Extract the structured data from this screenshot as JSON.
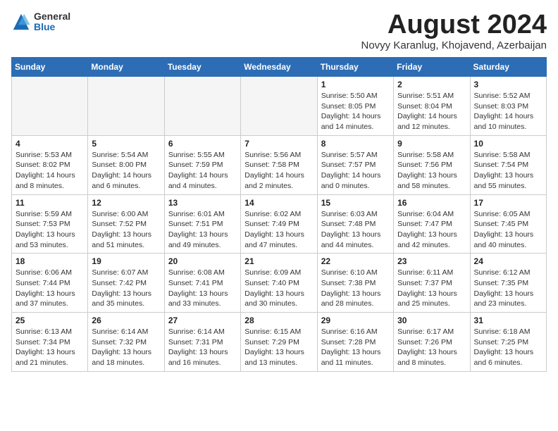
{
  "logo": {
    "general": "General",
    "blue": "Blue"
  },
  "title": "August 2024",
  "subtitle": "Novyy Karanlug, Khojavend, Azerbaijan",
  "headers": [
    "Sunday",
    "Monday",
    "Tuesday",
    "Wednesday",
    "Thursday",
    "Friday",
    "Saturday"
  ],
  "weeks": [
    [
      {
        "day": "",
        "info": ""
      },
      {
        "day": "",
        "info": ""
      },
      {
        "day": "",
        "info": ""
      },
      {
        "day": "",
        "info": ""
      },
      {
        "day": "1",
        "info": "Sunrise: 5:50 AM\nSunset: 8:05 PM\nDaylight: 14 hours\nand 14 minutes."
      },
      {
        "day": "2",
        "info": "Sunrise: 5:51 AM\nSunset: 8:04 PM\nDaylight: 14 hours\nand 12 minutes."
      },
      {
        "day": "3",
        "info": "Sunrise: 5:52 AM\nSunset: 8:03 PM\nDaylight: 14 hours\nand 10 minutes."
      }
    ],
    [
      {
        "day": "4",
        "info": "Sunrise: 5:53 AM\nSunset: 8:02 PM\nDaylight: 14 hours\nand 8 minutes."
      },
      {
        "day": "5",
        "info": "Sunrise: 5:54 AM\nSunset: 8:00 PM\nDaylight: 14 hours\nand 6 minutes."
      },
      {
        "day": "6",
        "info": "Sunrise: 5:55 AM\nSunset: 7:59 PM\nDaylight: 14 hours\nand 4 minutes."
      },
      {
        "day": "7",
        "info": "Sunrise: 5:56 AM\nSunset: 7:58 PM\nDaylight: 14 hours\nand 2 minutes."
      },
      {
        "day": "8",
        "info": "Sunrise: 5:57 AM\nSunset: 7:57 PM\nDaylight: 14 hours\nand 0 minutes."
      },
      {
        "day": "9",
        "info": "Sunrise: 5:58 AM\nSunset: 7:56 PM\nDaylight: 13 hours\nand 58 minutes."
      },
      {
        "day": "10",
        "info": "Sunrise: 5:58 AM\nSunset: 7:54 PM\nDaylight: 13 hours\nand 55 minutes."
      }
    ],
    [
      {
        "day": "11",
        "info": "Sunrise: 5:59 AM\nSunset: 7:53 PM\nDaylight: 13 hours\nand 53 minutes."
      },
      {
        "day": "12",
        "info": "Sunrise: 6:00 AM\nSunset: 7:52 PM\nDaylight: 13 hours\nand 51 minutes."
      },
      {
        "day": "13",
        "info": "Sunrise: 6:01 AM\nSunset: 7:51 PM\nDaylight: 13 hours\nand 49 minutes."
      },
      {
        "day": "14",
        "info": "Sunrise: 6:02 AM\nSunset: 7:49 PM\nDaylight: 13 hours\nand 47 minutes."
      },
      {
        "day": "15",
        "info": "Sunrise: 6:03 AM\nSunset: 7:48 PM\nDaylight: 13 hours\nand 44 minutes."
      },
      {
        "day": "16",
        "info": "Sunrise: 6:04 AM\nSunset: 7:47 PM\nDaylight: 13 hours\nand 42 minutes."
      },
      {
        "day": "17",
        "info": "Sunrise: 6:05 AM\nSunset: 7:45 PM\nDaylight: 13 hours\nand 40 minutes."
      }
    ],
    [
      {
        "day": "18",
        "info": "Sunrise: 6:06 AM\nSunset: 7:44 PM\nDaylight: 13 hours\nand 37 minutes."
      },
      {
        "day": "19",
        "info": "Sunrise: 6:07 AM\nSunset: 7:42 PM\nDaylight: 13 hours\nand 35 minutes."
      },
      {
        "day": "20",
        "info": "Sunrise: 6:08 AM\nSunset: 7:41 PM\nDaylight: 13 hours\nand 33 minutes."
      },
      {
        "day": "21",
        "info": "Sunrise: 6:09 AM\nSunset: 7:40 PM\nDaylight: 13 hours\nand 30 minutes."
      },
      {
        "day": "22",
        "info": "Sunrise: 6:10 AM\nSunset: 7:38 PM\nDaylight: 13 hours\nand 28 minutes."
      },
      {
        "day": "23",
        "info": "Sunrise: 6:11 AM\nSunset: 7:37 PM\nDaylight: 13 hours\nand 25 minutes."
      },
      {
        "day": "24",
        "info": "Sunrise: 6:12 AM\nSunset: 7:35 PM\nDaylight: 13 hours\nand 23 minutes."
      }
    ],
    [
      {
        "day": "25",
        "info": "Sunrise: 6:13 AM\nSunset: 7:34 PM\nDaylight: 13 hours\nand 21 minutes."
      },
      {
        "day": "26",
        "info": "Sunrise: 6:14 AM\nSunset: 7:32 PM\nDaylight: 13 hours\nand 18 minutes."
      },
      {
        "day": "27",
        "info": "Sunrise: 6:14 AM\nSunset: 7:31 PM\nDaylight: 13 hours\nand 16 minutes."
      },
      {
        "day": "28",
        "info": "Sunrise: 6:15 AM\nSunset: 7:29 PM\nDaylight: 13 hours\nand 13 minutes."
      },
      {
        "day": "29",
        "info": "Sunrise: 6:16 AM\nSunset: 7:28 PM\nDaylight: 13 hours\nand 11 minutes."
      },
      {
        "day": "30",
        "info": "Sunrise: 6:17 AM\nSunset: 7:26 PM\nDaylight: 13 hours\nand 8 minutes."
      },
      {
        "day": "31",
        "info": "Sunrise: 6:18 AM\nSunset: 7:25 PM\nDaylight: 13 hours\nand 6 minutes."
      }
    ]
  ]
}
